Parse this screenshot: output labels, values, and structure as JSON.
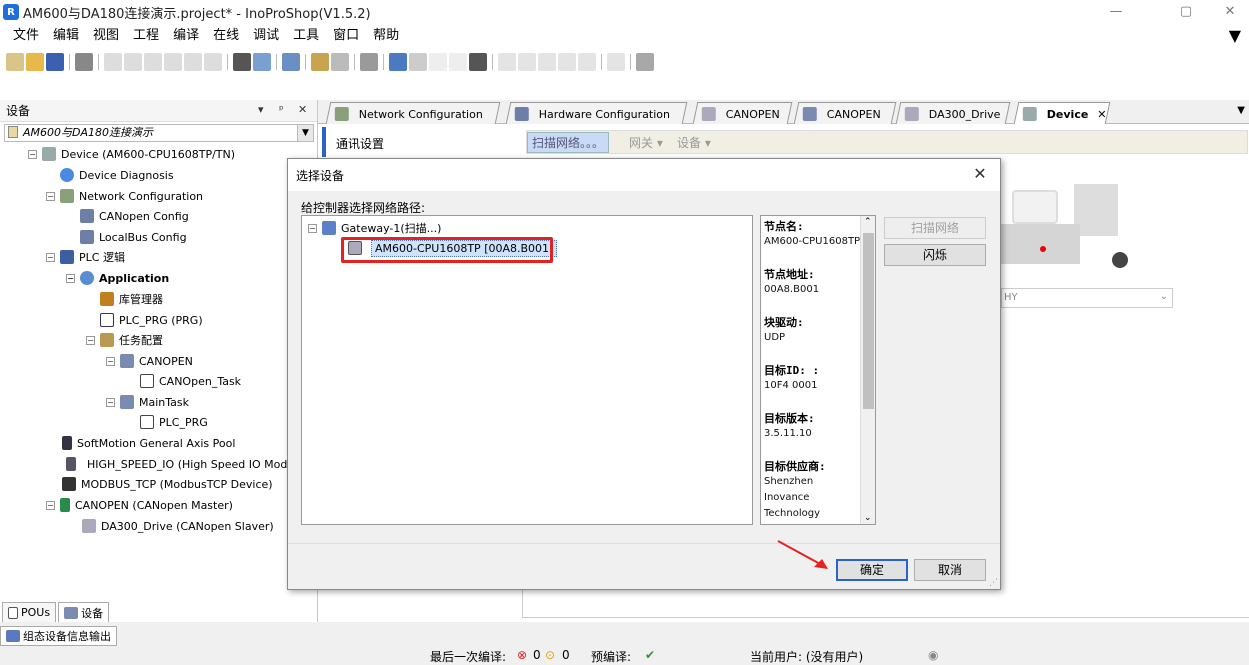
{
  "window": {
    "title": "AM600与DA180连接演示.project* - InoProShop(V1.5.2)",
    "app_icon_letter": "R",
    "minimize": "—",
    "maximize": "▢",
    "close": "✕"
  },
  "menu": [
    "文件",
    "编辑",
    "视图",
    "工程",
    "编译",
    "在线",
    "调试",
    "工具",
    "窗口",
    "帮助"
  ],
  "left_panel": {
    "header": "设备",
    "pin": "ᵖ",
    "dropdown": "▾",
    "close": "✕",
    "project_node": "AM600与DA180连接演示",
    "tree": [
      {
        "label": "Device (AM600-CPU1608TP/TN)",
        "icon": "device-icon"
      },
      {
        "label": "Device Diagnosis",
        "icon": "diagnosis-icon"
      },
      {
        "label": "Network Configuration",
        "icon": "network-config-icon"
      },
      {
        "label": "CANopen Config",
        "icon": "canopen-config-icon"
      },
      {
        "label": "LocalBus Config",
        "icon": "localbus-icon"
      },
      {
        "label": "PLC 逻辑",
        "icon": "plc-logic-icon"
      },
      {
        "label": "Application",
        "icon": "application-icon"
      },
      {
        "label": "库管理器",
        "icon": "library-icon"
      },
      {
        "label": "PLC_PRG (PRG)",
        "icon": "program-icon"
      },
      {
        "label": "任务配置",
        "icon": "task-config-icon"
      },
      {
        "label": "CANOPEN",
        "icon": "task-icon"
      },
      {
        "label": "CANOpen_Task",
        "icon": "task-call-icon"
      },
      {
        "label": "MainTask",
        "icon": "task-icon"
      },
      {
        "label": "PLC_PRG",
        "icon": "task-call-icon"
      },
      {
        "label": "SoftMotion General Axis Pool",
        "icon": "axis-pool-icon"
      },
      {
        "label": "HIGH_SPEED_IO (High Speed IO Module)",
        "icon": "io-module-icon"
      },
      {
        "label": "MODBUS_TCP (ModbusTCP Device)",
        "icon": "modbus-icon"
      },
      {
        "label": "CANOPEN (CANopen Master)",
        "icon": "canopen-master-icon"
      },
      {
        "label": "DA300_Drive (CANopen Slaver)",
        "icon": "slave-drive-icon"
      }
    ],
    "bottom_tabs": [
      "POUs",
      "设备"
    ],
    "output_tab": "组态设备信息输出"
  },
  "editor": {
    "tabs": [
      "Network Configuration",
      "Hardware Configuration",
      "CANOPEN",
      "CANOPEN",
      "DA300_Drive",
      "Device"
    ],
    "comm_settings": "通讯设置",
    "scan_network": "扫描网络。。。",
    "gateway_menu": "网关 ▾",
    "device_menu": "设备 ▾",
    "combo_value": "HY"
  },
  "dialog": {
    "title": "选择设备",
    "prompt": "给控制器选择网络路径:",
    "gateway": "Gateway-1(扫描...)",
    "device_node": "AM600-CPU1608TP [00A8.B001]",
    "info": [
      {
        "label": "节点名:",
        "value": "AM600-CPU1608TP"
      },
      {
        "label": "节点地址:",
        "value": "00A8.B001"
      },
      {
        "label": "块驱动:",
        "value": "UDP"
      },
      {
        "label": "目标ID: :",
        "value": "10F4 0001"
      },
      {
        "label": "目标版本:",
        "value": "3.5.11.10"
      },
      {
        "label": "目标供应商:",
        "value": "Shenzhen Inovance Technology"
      }
    ],
    "scan_button": "扫描网络",
    "blink_button": "闪烁",
    "ok_button": "确定",
    "cancel_button": "取消",
    "highlight_color": "#e52222"
  },
  "status": {
    "last_compile": "最后一次编译:",
    "errors": "0",
    "warnings": "0",
    "precompile": "预编译:",
    "precompile_ok": "✔",
    "current_user": "当前用户: (没有用户)"
  }
}
